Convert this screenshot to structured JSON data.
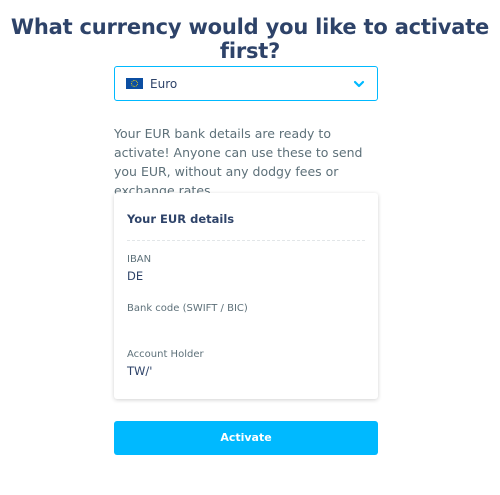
{
  "page": {
    "title": "What currency would you like to activate first?"
  },
  "currency_select": {
    "selected_label": "Euro",
    "flag_icon": "eu-flag-icon",
    "chevron_icon": "chevron-down-icon",
    "border_color": "#00b9ff"
  },
  "description": "Your EUR bank details are ready to activate! Anyone can use these to send you EUR, without any dodgy fees or exchange rates.",
  "details_card": {
    "title": "Your EUR details",
    "fields": [
      {
        "label": "IBAN",
        "value": "DE"
      },
      {
        "label": "Bank code (SWIFT / BIC)",
        "value": ""
      },
      {
        "label": "Account Holder",
        "value": "TW/'"
      }
    ]
  },
  "activate_button": {
    "label": "Activate",
    "color": "#00b9ff"
  },
  "colors": {
    "heading": "#2e4369",
    "body_text": "#5d7079",
    "accent": "#00b9ff"
  }
}
